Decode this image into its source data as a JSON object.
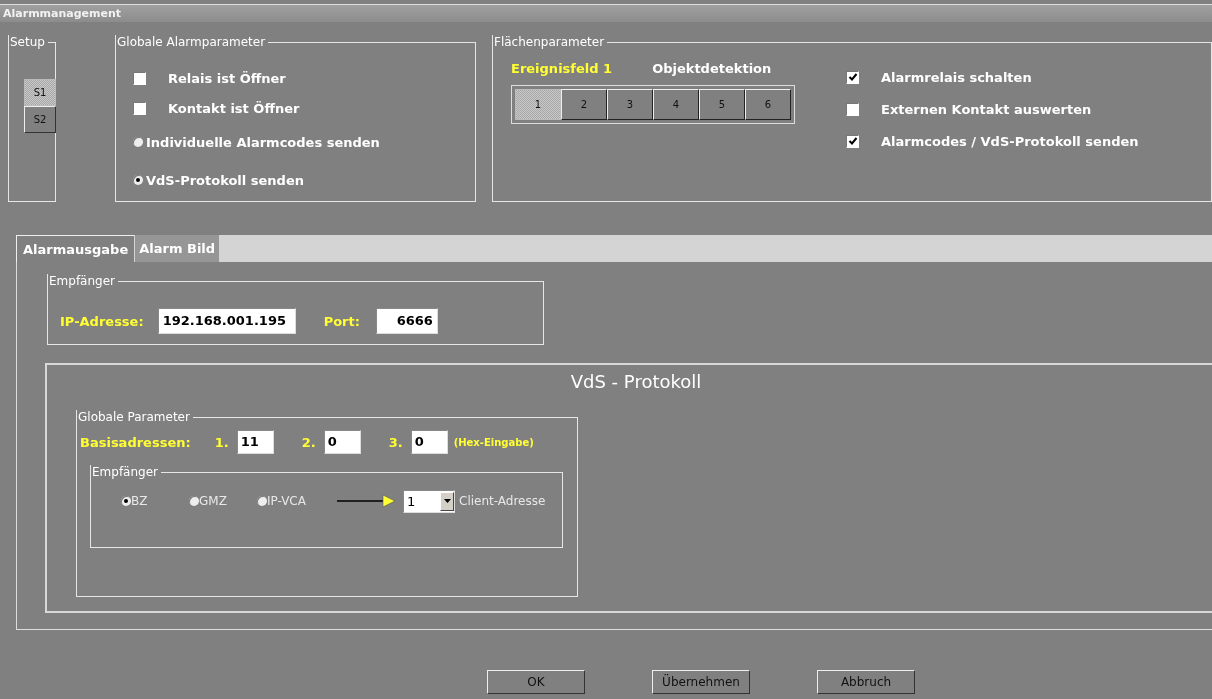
{
  "window": {
    "title": "Alarmmanagement"
  },
  "setup": {
    "title": "Setup",
    "buttons": [
      {
        "label": "S1",
        "selected": true
      },
      {
        "label": "S2",
        "selected": false
      }
    ]
  },
  "global_alarm": {
    "title": "Globale Alarmparameter",
    "options": [
      {
        "kind": "checkbox",
        "label": "Relais ist Öffner",
        "checked": false
      },
      {
        "kind": "checkbox",
        "label": "Kontakt ist Öffner",
        "checked": false
      },
      {
        "kind": "radio",
        "label": "Individuelle Alarmcodes senden",
        "selected": false
      },
      {
        "kind": "radio",
        "label": "VdS-Protokoll senden",
        "selected": true
      }
    ]
  },
  "area": {
    "title": "Flächenparameter",
    "field_label": "Ereignisfeld 1",
    "detection": "Objektdetektion",
    "fields": [
      {
        "label": "1",
        "selected": true
      },
      {
        "label": "2",
        "selected": false
      },
      {
        "label": "3",
        "selected": false
      },
      {
        "label": "4",
        "selected": false
      },
      {
        "label": "5",
        "selected": false
      },
      {
        "label": "6",
        "selected": false
      }
    ],
    "options": [
      {
        "label": "Alarmrelais schalten",
        "checked": true
      },
      {
        "label": "Externen Kontakt auswerten",
        "checked": false
      },
      {
        "label": "Alarmcodes / VdS-Protokoll senden",
        "checked": true
      }
    ]
  },
  "tabs": [
    {
      "label": "Alarmausgabe",
      "selected": true
    },
    {
      "label": "Alarm Bild",
      "selected": false
    }
  ],
  "receiver": {
    "title": "Empfänger",
    "ip_label": "IP-Adresse:",
    "ip": "192.168.001.195",
    "port_label": "Port:",
    "port": "6666"
  },
  "vds": {
    "title": "VdS - Protokoll",
    "global": {
      "title": "Globale Parameter",
      "base_label": "Basisadressen:",
      "addresses": [
        {
          "label": "1.",
          "value": "11"
        },
        {
          "label": "2.",
          "value": "0"
        },
        {
          "label": "3.",
          "value": "0"
        }
      ],
      "hint": "(Hex-Eingabe)"
    },
    "receiver": {
      "title": "Empfänger",
      "options": [
        {
          "label": "BZ",
          "selected": true
        },
        {
          "label": "GMZ",
          "selected": false
        },
        {
          "label": "IP-VCA",
          "selected": false
        }
      ],
      "client": "1",
      "client_label": "Client-Adresse"
    }
  },
  "buttons": [
    "OK",
    "Übernehmen",
    "Abbruch"
  ]
}
